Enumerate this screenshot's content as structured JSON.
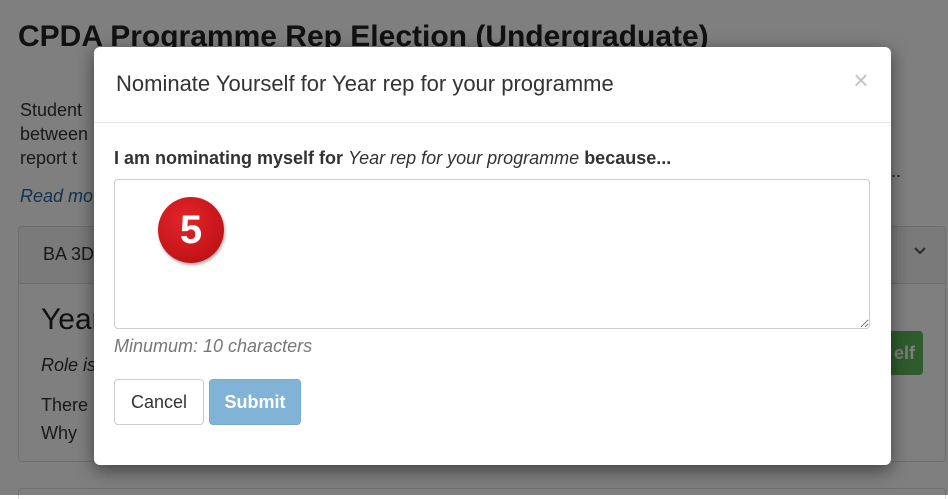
{
  "background": {
    "page_title": "CPDA Programme Rep Election (Undergraduate)",
    "description_lines": [
      "Student",
      "between",
      "report t"
    ],
    "ellipsis": "...",
    "read_more": "Read mo",
    "panel_header": "BA 3D",
    "role_title": "Year",
    "role_subtitle": "Role is",
    "role_line1": "There",
    "role_line2": "Why",
    "nominate_button_partial": "elf"
  },
  "modal": {
    "title": "Nominate Yourself for Year rep for your programme",
    "close_glyph": "×",
    "label_prefix": "I am nominating myself for",
    "label_role": "Year rep for your programme",
    "label_suffix": "because...",
    "textarea_value": "",
    "step_badge": "5",
    "hint": "Minumum: 10 characters",
    "cancel_label": "Cancel",
    "submit_label": "Submit"
  },
  "colors": {
    "submit_disabled": "#81b3d6",
    "badge_red": "#c8161b",
    "success_green": "#5cb85c",
    "link_blue": "#2a6496"
  },
  "icons": {
    "close": "close-icon",
    "chevron": "chevron-down-icon"
  }
}
